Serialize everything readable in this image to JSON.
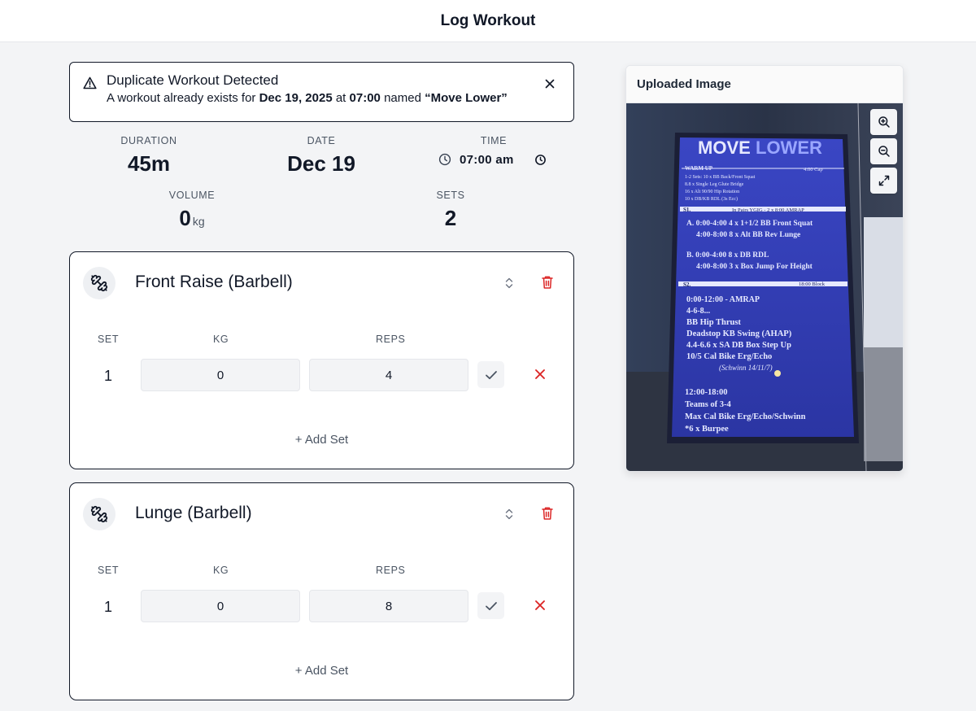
{
  "header": {
    "title": "Log Workout"
  },
  "alert": {
    "title": "Duplicate Workout Detected",
    "desc_prefix": "A workout already exists for",
    "date": "Dec 19, 2025",
    "desc_at": "at",
    "time": "07:00",
    "desc_named": "named",
    "name": "“Move Lower”"
  },
  "stats": {
    "duration": {
      "label": "DURATION",
      "value": "45m"
    },
    "date": {
      "label": "DATE",
      "value": "Dec 19"
    },
    "time": {
      "label": "TIME",
      "value": "07:00 am"
    },
    "volume": {
      "label": "VOLUME",
      "value": "0",
      "unit": "kg"
    },
    "sets": {
      "label": "SETS",
      "value": "2"
    }
  },
  "exercises": [
    {
      "name": "Front Raise (Barbell)",
      "headers": {
        "set": "SET",
        "kg": "KG",
        "reps": "REPS"
      },
      "sets": [
        {
          "set": "1",
          "kg": "0",
          "reps": "4"
        }
      ],
      "add_set": "+ Add Set"
    },
    {
      "name": "Lunge (Barbell)",
      "headers": {
        "set": "SET",
        "kg": "KG",
        "reps": "REPS"
      },
      "sets": [
        {
          "set": "1",
          "kg": "0",
          "reps": "8"
        }
      ],
      "add_set": "+ Add Set"
    }
  ],
  "image_panel": {
    "title": "Uploaded Image",
    "board": {
      "title_move": "MOVE",
      "title_lower": "LOWER",
      "warmup": "WARM UP",
      "warmup_cap": "4:00 Cap",
      "warmup_lines": [
        "1-2 Sets: 10 x BB Back/Front Squat",
        "8.8 x Single Leg Glute Bridge",
        "16 x Alt 90/90 Hip Rotation",
        "10 x DB/KB RDL (3s Ecc)"
      ],
      "s1": "S1.",
      "s1_note": "In Pairs YGIG - 2 x 8:00 AMRAP",
      "s1_lines": [
        "A. 0:00-4:00 4 x 1+1/2 BB Front Squat",
        "4:00-8:00 8 x Alt BB Rev Lunge",
        "B. 0:00-4:00 8 x DB RDL",
        "4:00-8:00 3 x Box Jump For Height"
      ],
      "s2": "S2.",
      "s2_note": "18:00 Block",
      "s2_lines": [
        "0:00-12:00 - AMRAP",
        "4-6-8...",
        "BB Hip Thrust",
        "Deadstop KB Swing (AHAP)",
        "4.4-6.6 x SA DB Box Step Up",
        "10/5 Cal Bike Erg/Echo",
        "(Schwinn 14/11/7)",
        "12:00-18:00",
        "Teams of 3-4",
        "Max Cal Bike Erg/Echo/Schwinn",
        "*6 x Burpee"
      ]
    }
  },
  "colors": {
    "accent_red": "#dc2626",
    "board_blue": "#3440b8",
    "text_dark": "#111827"
  },
  "icons": {
    "dumbbell": "dumbbell-icon",
    "warning": "warning-icon",
    "close": "close-icon",
    "clock": "clock-icon",
    "sort": "sort-icon",
    "trash": "trash-icon",
    "check": "check-icon",
    "delete": "x-icon",
    "zoom_in": "zoom-in-icon",
    "zoom_out": "zoom-out-icon",
    "expand": "expand-icon"
  }
}
